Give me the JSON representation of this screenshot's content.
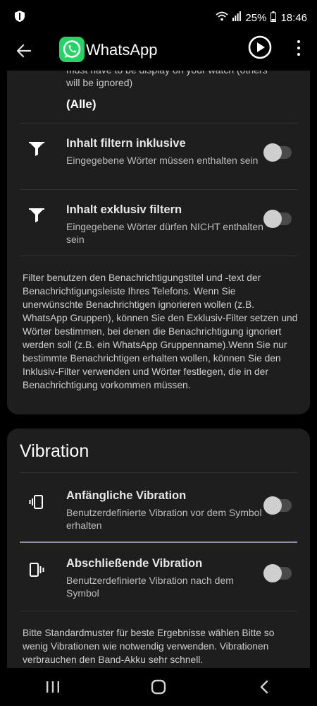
{
  "status_bar": {
    "battery": "25%",
    "time": "18:46"
  },
  "app_bar": {
    "title": "WhatsApp"
  },
  "card_filters": {
    "clipped_text": "must have to be display on your watch (others will be ignored)",
    "clipped_value": "(Alle)",
    "rows": [
      {
        "title": "Inhalt filtern inklusive",
        "subtitle": "Eingegebene Wörter müssen enthalten sein",
        "enabled": false
      },
      {
        "title": "Inhalt exklusiv filtern",
        "subtitle": "Eingegebene Wörter dürfen NICHT enthalten sein",
        "enabled": false
      }
    ],
    "info": "Filter benutzen den Benachrichtigungstitel und -text der Benachrichtigungsleiste Ihres Telefons. Wenn Sie unerwünschte Benachrichtigen ignorieren wollen (z.B. WhatsApp Gruppen), können Sie den Exklusiv-Filter setzen und Wörter bestimmen, bei denen die Benachrichtigung ignoriert werden soll (z.B. ein WhatsApp Gruppenname).Wenn Sie nur bestimmte Benachrichtigen erhalten wollen, können Sie den Inklusiv-Filter verwenden und Wörter festlegen, die in der Benachrichtigung vorkommen müssen."
  },
  "card_vibration": {
    "title": "Vibration",
    "rows": [
      {
        "title": "Anfängliche Vibration",
        "subtitle": "Benutzerdefinierte Vibration vor dem Symbol erhalten",
        "enabled": false
      },
      {
        "title": "Abschließende Vibration",
        "subtitle": "Benutzerdefinierte Vibration nach dem Symbol",
        "enabled": false
      }
    ],
    "info": "Bitte Standardmuster für beste Ergebnisse wählen Bitte so wenig Vibrationen wie notwendig verwenden. Vibrationen verbrauchen den Band-Akku sehr schnell."
  },
  "colors": {
    "background": "#000000",
    "card": "#1e1e1e",
    "whatsapp_green": "#25d366",
    "toggle_track_off": "#4a4a4a",
    "toggle_thumb_off": "#cfcfcf"
  },
  "icons": {
    "status_left": "shield-icon",
    "wifi": "wifi-icon",
    "signal": "signal-icon",
    "battery": "battery-icon",
    "back": "arrow-back-icon",
    "play": "play-circle-icon",
    "more": "more-vert-icon",
    "filter": "filter-funnel-icon",
    "vibration_start": "vibration-start-icon",
    "vibration_end": "vibration-end-icon",
    "nav_recents": "recents-icon",
    "nav_home": "home-icon",
    "nav_back": "nav-back-icon"
  }
}
